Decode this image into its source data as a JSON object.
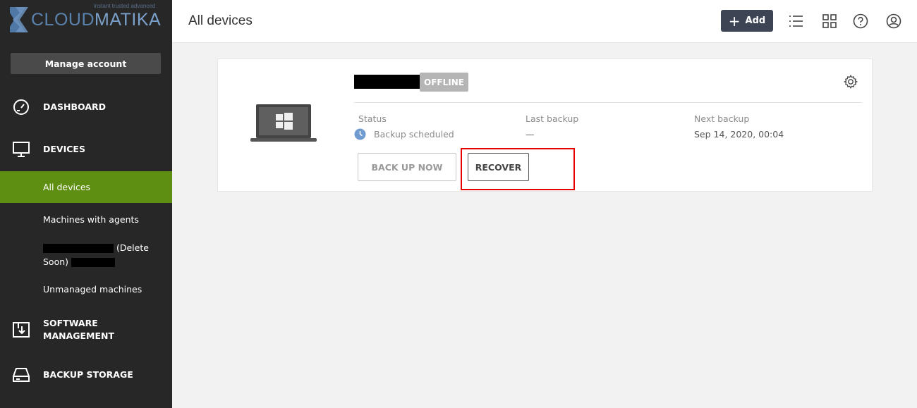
{
  "brand": {
    "tagline": "instant trusted advanced",
    "name_part1": "CLOUD",
    "name_part2": "MATIKA"
  },
  "sidebar": {
    "manage_account": "Manage account",
    "dashboard": "DASHBOARD",
    "devices": "DEVICES",
    "sub_items": {
      "all_devices": "All devices",
      "machines_with_agents": "Machines with agents",
      "delete_soon_part1": "(Delete",
      "delete_soon_part2": "Soon)",
      "unmanaged_machines": "Unmanaged machines"
    },
    "software_management_line1": "SOFTWARE",
    "software_management_line2": "MANAGEMENT",
    "backup_storage": "BACKUP STORAGE"
  },
  "header": {
    "title": "All devices",
    "add_label": "Add",
    "add_plus": "+"
  },
  "device_card": {
    "status_badge": "OFFLINE",
    "status_label": "Status",
    "status_value": "Backup scheduled",
    "last_backup_label": "Last backup",
    "last_backup_value": "—",
    "next_backup_label": "Next backup",
    "next_backup_value": "Sep 14, 2020, 00:04",
    "back_up_now": "BACK UP NOW",
    "recover": "RECOVER"
  },
  "colors": {
    "sidebar_bg": "#272727",
    "active_item": "#5e8e12",
    "header_button": "#3d4554",
    "highlight": "#e60000",
    "status_icon": "#6f9bd1"
  }
}
